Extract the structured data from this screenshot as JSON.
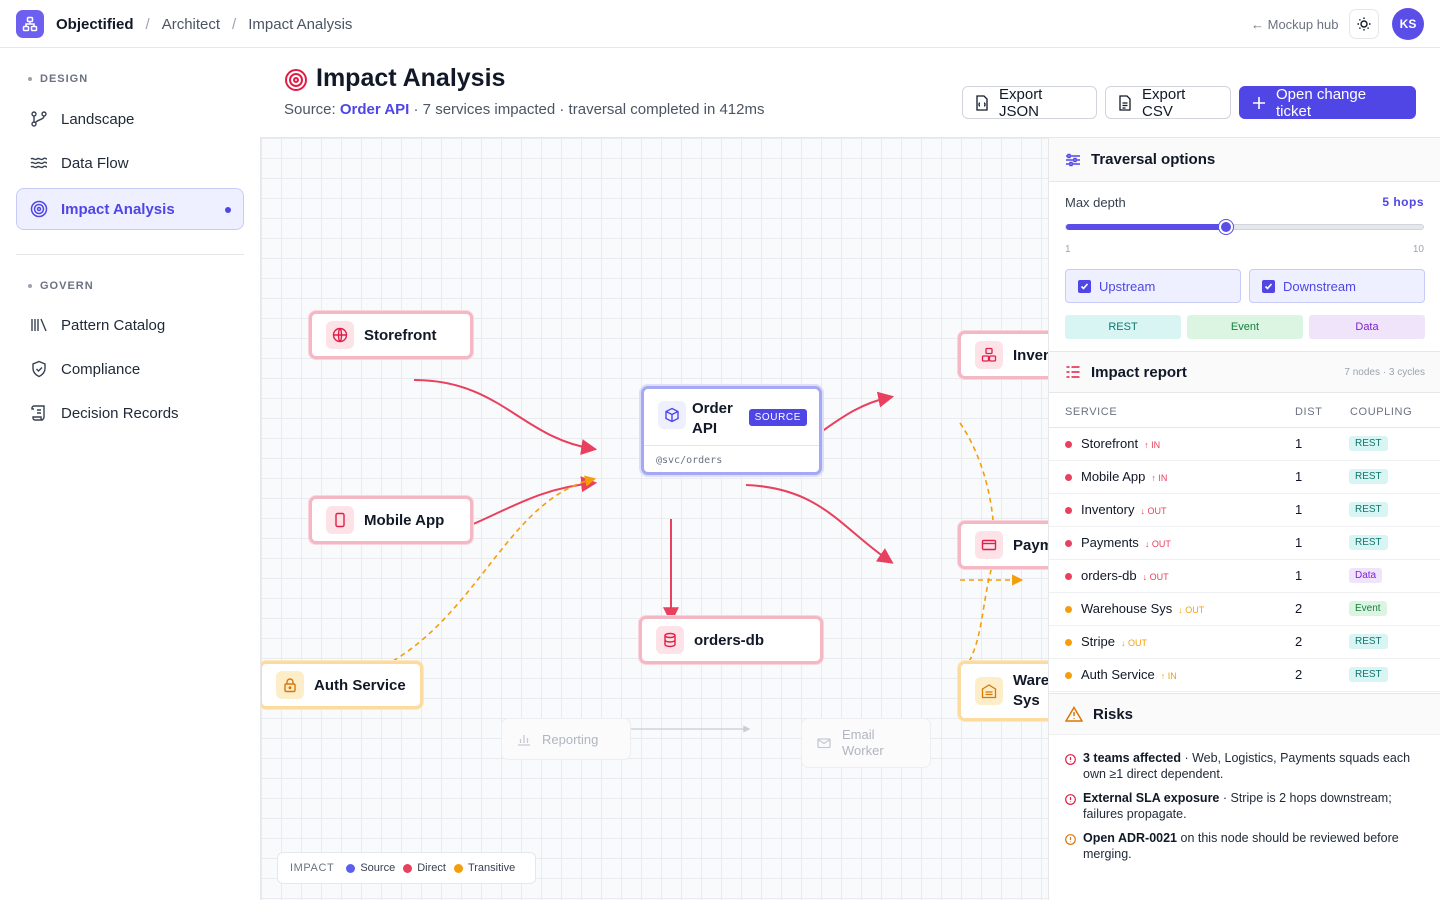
{
  "header": {
    "app_name": "Objectified",
    "breadcrumb": [
      "Architect",
      "Impact Analysis"
    ],
    "hub_link": "← Mockup hub",
    "avatar_initials": "KS"
  },
  "sidebar": {
    "sections": [
      {
        "label": "DESIGN",
        "items": [
          {
            "label": "Landscape",
            "icon": "branch-icon"
          },
          {
            "label": "Data Flow",
            "icon": "waves-icon"
          },
          {
            "label": "Impact Analysis",
            "icon": "target-icon",
            "active": true
          }
        ]
      },
      {
        "label": "GOVERN",
        "items": [
          {
            "label": "Pattern Catalog",
            "icon": "library-icon"
          },
          {
            "label": "Compliance",
            "icon": "shield-icon"
          },
          {
            "label": "Decision Records",
            "icon": "scroll-icon"
          }
        ]
      }
    ]
  },
  "page": {
    "title": "Impact Analysis",
    "subtitle_prefix": "Source:",
    "source_name": "Order API",
    "subtitle_rest": "· 7 services impacted · traversal completed in 412ms",
    "buttons": {
      "export_json": "Export JSON",
      "export_csv": "Export CSV",
      "open_ticket": "Open change ticket"
    }
  },
  "graph": {
    "source": {
      "name": "Order API",
      "badge": "SOURCE",
      "path": "@svc/orders"
    },
    "nodes": {
      "storefront": "Storefront",
      "mobile_app": "Mobile App",
      "auth_service": "Auth Service",
      "orders_db": "orders-db",
      "inventory": "Inven",
      "payments": "Paym",
      "warehouse": "Wareh Sys",
      "reporting": "Reporting",
      "email_worker": "Email Worker"
    },
    "legend": {
      "label": "IMPACT",
      "source": "Source",
      "direct": "Direct",
      "transitive": "Transitive"
    },
    "colors": {
      "source": "#5b5ff0",
      "direct": "#e8405e",
      "transitive": "#f59e0b"
    }
  },
  "traversal": {
    "title": "Traversal options",
    "max_depth_label": "Max depth",
    "max_depth_value": "5  hops",
    "depth": 5,
    "depth_min": 1,
    "depth_max": 10,
    "min_label": "1",
    "max_label": "10",
    "upstream": "Upstream",
    "downstream": "Downstream",
    "coupling_filters": [
      "REST",
      "Event",
      "Data"
    ]
  },
  "report": {
    "title": "Impact report",
    "meta": "7 nodes · 3 cycles",
    "columns": [
      "SERVICE",
      "DIST",
      "COUPLING"
    ],
    "rows": [
      {
        "service": "Storefront",
        "dir": "↑ IN",
        "dist": "1",
        "coupling": "REST",
        "level": "direct"
      },
      {
        "service": "Mobile App",
        "dir": "↑ IN",
        "dist": "1",
        "coupling": "REST",
        "level": "direct"
      },
      {
        "service": "Inventory",
        "dir": "↓ OUT",
        "dist": "1",
        "coupling": "REST",
        "level": "direct"
      },
      {
        "service": "Payments",
        "dir": "↓ OUT",
        "dist": "1",
        "coupling": "REST",
        "level": "direct"
      },
      {
        "service": "orders-db",
        "dir": "↓ OUT",
        "dist": "1",
        "coupling": "Data",
        "level": "direct"
      },
      {
        "service": "Warehouse Sys",
        "dir": "↓ OUT",
        "dist": "2",
        "coupling": "Event",
        "level": "transitive"
      },
      {
        "service": "Stripe",
        "dir": "↓ OUT",
        "dist": "2",
        "coupling": "REST",
        "level": "transitive"
      },
      {
        "service": "Auth Service",
        "dir": "↑ IN",
        "dist": "2",
        "coupling": "REST",
        "level": "transitive"
      }
    ]
  },
  "risks": {
    "title": "Risks",
    "items": [
      {
        "bold": "3 teams affected",
        "text": " · Web, Logistics, Payments squads each own ≥1 direct dependent."
      },
      {
        "bold": "External SLA exposure",
        "text": " · Stripe is 2 hops downstream; failures propagate."
      },
      {
        "bold": "Open ADR-0021",
        "text": " on this node should be reviewed before merging."
      }
    ]
  }
}
